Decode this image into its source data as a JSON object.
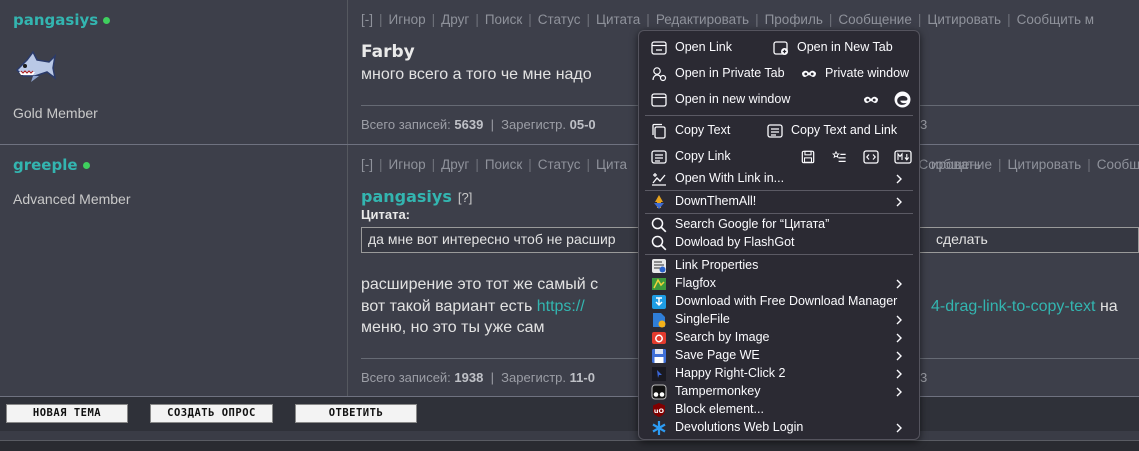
{
  "posts": [
    {
      "author": "pangasiys",
      "rank": "Gold Member",
      "actions": [
        "[-]",
        "Игнор",
        "Друг",
        "Поиск",
        "Статус",
        "Цитата",
        "Редактировать",
        "Профиль",
        "Сообщение",
        "Цитировать",
        "Сообщить м"
      ],
      "title": "Farby",
      "text": "много всего а того че мне надо",
      "stats_label1": "Всего записей:",
      "stats_count": "5639",
      "stats_label2": "Зарегистр.",
      "stats_date": "05-0",
      "stats_tail": "3"
    },
    {
      "author": "greeple",
      "rank": "Advanced Member",
      "actions": [
        "[-]",
        "Игнор",
        "Друг",
        "Поиск",
        "Статус",
        "Цита",
        "ировать",
        "Сообщение",
        "Цитировать",
        "Сообщить м"
      ],
      "quote_author": "pangasiys",
      "quote_q": "[?]",
      "quote_label": "Цитата:",
      "quote_text_left": "да мне вот интересно чтоб не расшир",
      "quote_text_right": "сделать",
      "line1": "расширение это тот же самый с",
      "line2_prefix": "вот такой вариант есть ",
      "line2_link": "https://",
      "line2_link_right": "4-drag-link-to-copy-text",
      "line2_suffix": " на",
      "line3": "меню, но это ты уже сам",
      "stats_label1": "Всего записей:",
      "stats_count": "1938",
      "stats_label2": "Зарегистр.",
      "stats_date": "11-0",
      "stats_tail": "3"
    }
  ],
  "buttons": {
    "new_topic": "НОВАЯ ТЕМА",
    "create_poll": "СОЗДАТЬ ОПРОС",
    "reply": "ОТВЕТИТЬ"
  },
  "context_menu": {
    "open_link": "Open Link",
    "open_new_tab": "Open in New Tab",
    "open_private_tab": "Open in Private Tab",
    "private_window": "Private window",
    "open_new_window": "Open in new window",
    "copy_text": "Copy Text",
    "copy_text_link": "Copy Text and Link",
    "copy_link": "Copy Link",
    "open_with_link": "Open With Link in...",
    "downthemall": "DownThemAll!",
    "search_google": "Search Google for “Цитата”",
    "download_flashgot": "Dowload by FlashGot",
    "link_properties": "Link Properties",
    "flagfox": "Flagfox",
    "fdm": "Download with Free Download Manager",
    "singlefile": "SingleFile",
    "search_by_image": "Search by Image",
    "save_page_we": "Save Page WE",
    "happy_right_click": "Happy Right-Click 2",
    "tampermonkey": "Tampermonkey",
    "block_element": "Block element...",
    "devolutions": "Devolutions Web Login"
  },
  "colors": {
    "accent": "#33b5b0",
    "online": "#3fcf5e",
    "menu_bg": "#2b2a33",
    "page_bg": "#3d3f4a"
  }
}
